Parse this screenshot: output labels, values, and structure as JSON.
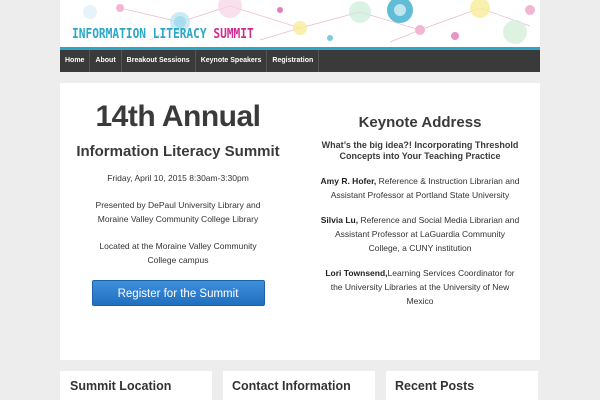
{
  "header": {
    "logo_word1": "INFORMATION",
    "logo_word2": "LITERACY",
    "logo_word3": "SUMMIT",
    "accent": "#2aa7c9",
    "accent2": "#d12a8f"
  },
  "nav": {
    "items": [
      "Home",
      "About",
      "Breakout Sessions",
      "Keynote Speakers",
      "Registration"
    ]
  },
  "left": {
    "title": "14th Annual",
    "subtitle": "Information Literacy Summit",
    "date": "Friday, April 10, 2015 8:30am-3:30pm",
    "presented_line1": "Presented by DePaul University Library and",
    "presented_line2": "Moraine Valley Community College Library",
    "located": "Located at the Moraine Valley Community College campus",
    "register_label": "Register for the Summit"
  },
  "right": {
    "heading": "Keynote Address",
    "question": "What’s the big idea?! Incorporating Threshold Concepts into Your Teaching Practice",
    "speakers": [
      {
        "name": "Amy R. Hofer,",
        "desc": " Reference & Instruction Librarian and Assistant Professor at Portland State University"
      },
      {
        "name": "Silvia Lu,",
        "desc": " Reference and Social Media Librarian and Assistant Professor at LaGuardia Community College, a CUNY institution"
      },
      {
        "name": "Lori Townsend,",
        "desc": "Learning Services Coordinator for the University Libraries at the University of New Mexico"
      }
    ]
  },
  "widgets": {
    "location": "Summit Location",
    "contact": "Contact Information",
    "recent": "Recent Posts"
  }
}
